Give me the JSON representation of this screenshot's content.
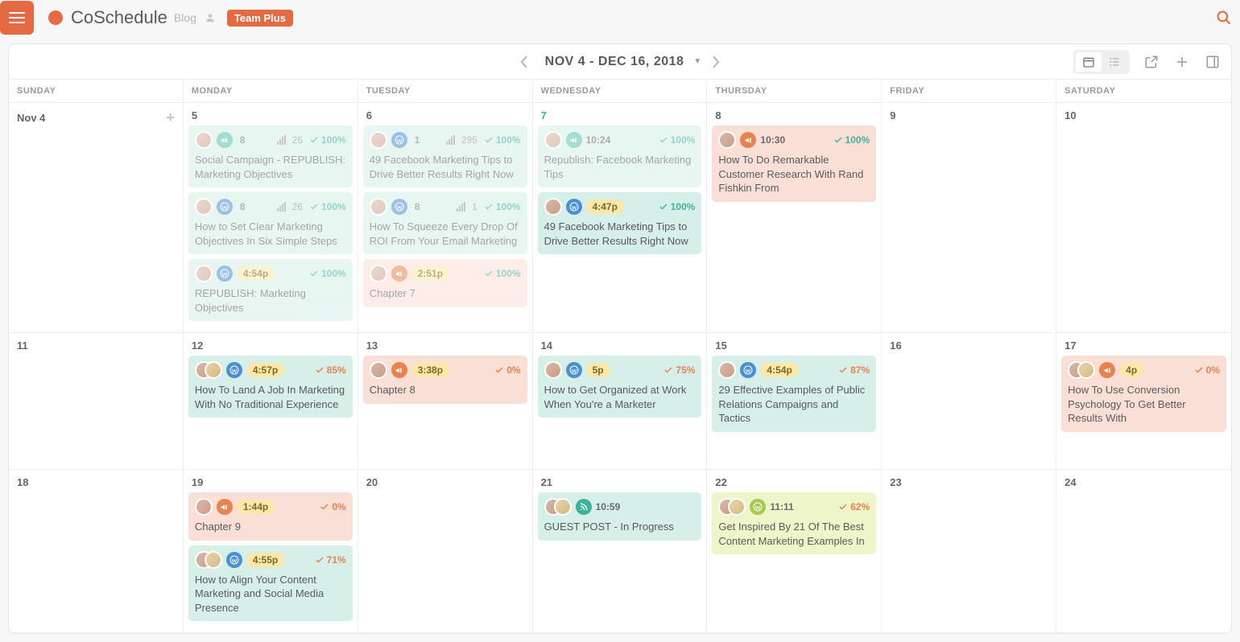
{
  "header": {
    "app_name": "CoSchedule",
    "blog_label": "Blog",
    "plan_badge": "Team Plus"
  },
  "calendar": {
    "range_label": "NOV 4 - DEC 16, 2018"
  },
  "days_of_week": [
    "SUNDAY",
    "MONDAY",
    "TUESDAY",
    "WEDNESDAY",
    "THURSDAY",
    "FRIDAY",
    "SATURDAY"
  ],
  "weeks": [
    {
      "days": [
        {
          "label": "Nov 4",
          "today": false,
          "show_add": true,
          "cards": []
        },
        {
          "label": "5",
          "today": false,
          "cards": [
            {
              "color": "teal",
              "faded": true,
              "icon": "teal-l",
              "icon_glyph": "mega",
              "time_mode": "count",
              "time": "8",
              "bars": true,
              "bars_val": "26",
              "pct": "100%",
              "pct_style": "ok",
              "title": "Social Campaign - REPUBLISH: Marketing Objectives"
            },
            {
              "color": "teal",
              "faded": true,
              "icon": "blue",
              "icon_glyph": "wp",
              "time_mode": "count",
              "time": "8",
              "bars": true,
              "bars_val": "26",
              "pct": "100%",
              "pct_style": "ok",
              "title": "How to Set Clear Marketing Objectives In Six Simple Steps"
            },
            {
              "color": "teal",
              "faded": true,
              "icon": "blue",
              "icon_glyph": "wp",
              "time_mode": "pill",
              "time": "4:54p",
              "pct": "100%",
              "pct_style": "ok",
              "title": "REPUBLISH: Marketing Objectives"
            }
          ]
        },
        {
          "label": "6",
          "today": false,
          "cards": [
            {
              "color": "teal",
              "faded": true,
              "icon": "blue",
              "icon_glyph": "wp",
              "time_mode": "count",
              "time": "1",
              "bars": true,
              "bars_val": "295",
              "pct": "100%",
              "pct_style": "ok",
              "title": "49 Facebook Marketing Tips to Drive Better Results Right Now"
            },
            {
              "color": "teal",
              "faded": true,
              "icon": "blue",
              "icon_glyph": "wp",
              "time_mode": "count",
              "time": "8",
              "bars": true,
              "bars_val": "1",
              "pct": "100%",
              "pct_style": "ok",
              "title": "How To Squeeze Every Drop Of ROI From Your Email Marketing"
            },
            {
              "color": "salmon",
              "faded": true,
              "icon": "orange",
              "icon_glyph": "mega",
              "time_mode": "pill",
              "time": "2:51p",
              "pct": "100%",
              "pct_style": "ok",
              "title": "Chapter 7"
            }
          ]
        },
        {
          "label": "7",
          "today": true,
          "cards": [
            {
              "color": "teal",
              "faded": true,
              "icon": "teal-l",
              "icon_glyph": "mega",
              "time_mode": "plain",
              "time": "10:24",
              "pct": "100%",
              "pct_style": "ok",
              "title": "Republish: Facebook Marketing Tips"
            },
            {
              "color": "teal",
              "faded": false,
              "icon": "blue",
              "icon_glyph": "wp",
              "time_mode": "pill",
              "time": "4:47p",
              "pct": "100%",
              "pct_style": "ok",
              "title": "49 Facebook Marketing Tips to Drive Better Results Right Now"
            }
          ]
        },
        {
          "label": "8",
          "today": false,
          "cards": [
            {
              "color": "salmon",
              "faded": false,
              "icon": "orange",
              "icon_glyph": "mega",
              "time_mode": "plain",
              "time": "10:30",
              "pct": "100%",
              "pct_style": "ok",
              "title": "How To Do Remarkable Customer Research With Rand Fishkin From"
            }
          ]
        },
        {
          "label": "9",
          "today": false,
          "cards": []
        },
        {
          "label": "10",
          "today": false,
          "cards": []
        }
      ]
    },
    {
      "days": [
        {
          "label": "11",
          "cards": []
        },
        {
          "label": "12",
          "cards": [
            {
              "color": "teal",
              "faded": false,
              "icon": "blue",
              "icon_glyph": "wp",
              "time_mode": "pill",
              "time": "4:57p",
              "pct": "85%",
              "pct_style": "warn",
              "title": "How To Land A Job In Marketing With No Traditional Experience",
              "pair": true
            }
          ]
        },
        {
          "label": "13",
          "cards": [
            {
              "color": "salmon",
              "faded": false,
              "icon": "orange",
              "icon_glyph": "mega",
              "time_mode": "pill",
              "time": "3:38p",
              "pct": "0%",
              "pct_style": "warn",
              "title": "Chapter 8"
            }
          ]
        },
        {
          "label": "14",
          "cards": [
            {
              "color": "teal",
              "faded": false,
              "icon": "blue",
              "icon_glyph": "wp",
              "time_mode": "pill",
              "time": "5p",
              "pct": "75%",
              "pct_style": "warn",
              "title": "How to Get Organized at Work When You're a Marketer"
            }
          ]
        },
        {
          "label": "15",
          "cards": [
            {
              "color": "teal",
              "faded": false,
              "icon": "blue",
              "icon_glyph": "wp",
              "time_mode": "pill",
              "time": "4:54p",
              "pct": "87%",
              "pct_style": "warn",
              "title": "29 Effective Examples of Public Relations Campaigns and Tactics"
            }
          ]
        },
        {
          "label": "16",
          "cards": []
        },
        {
          "label": "17",
          "cards": [
            {
              "color": "salmon",
              "faded": false,
              "icon": "orange",
              "icon_glyph": "mega",
              "time_mode": "pill",
              "time": "4p",
              "pct": "0%",
              "pct_style": "warn",
              "title": "How To Use Conversion Psychology To Get Better Results With",
              "pair": true
            }
          ]
        }
      ]
    },
    {
      "days": [
        {
          "label": "18",
          "cards": []
        },
        {
          "label": "19",
          "cards": [
            {
              "color": "salmon",
              "faded": false,
              "icon": "orange",
              "icon_glyph": "mega",
              "time_mode": "pill",
              "time": "1:44p",
              "pct": "0%",
              "pct_style": "warn",
              "title": "Chapter 9"
            },
            {
              "color": "teal",
              "faded": false,
              "icon": "blue",
              "icon_glyph": "wp",
              "time_mode": "pill",
              "time": "4:55p",
              "pct": "71%",
              "pct_style": "warn",
              "title": "How to Align Your Content Marketing and Social Media Presence",
              "pair": true
            }
          ]
        },
        {
          "label": "20",
          "cards": []
        },
        {
          "label": "21",
          "cards": [
            {
              "color": "teal",
              "faded": false,
              "icon": "teal",
              "icon_glyph": "rss",
              "time_mode": "plain",
              "time": "10:59",
              "pct": "",
              "title": "GUEST POST - In Progress",
              "pair": true
            }
          ]
        },
        {
          "label": "22",
          "cards": [
            {
              "color": "lime",
              "faded": false,
              "icon": "lime",
              "icon_glyph": "wp",
              "time_mode": "plain",
              "time": "11:11",
              "pct": "62%",
              "pct_style": "warn",
              "title": "Get Inspired By 21 Of The Best Content Marketing Examples In",
              "pair": true
            }
          ]
        },
        {
          "label": "23",
          "cards": []
        },
        {
          "label": "24",
          "cards": []
        }
      ]
    }
  ]
}
